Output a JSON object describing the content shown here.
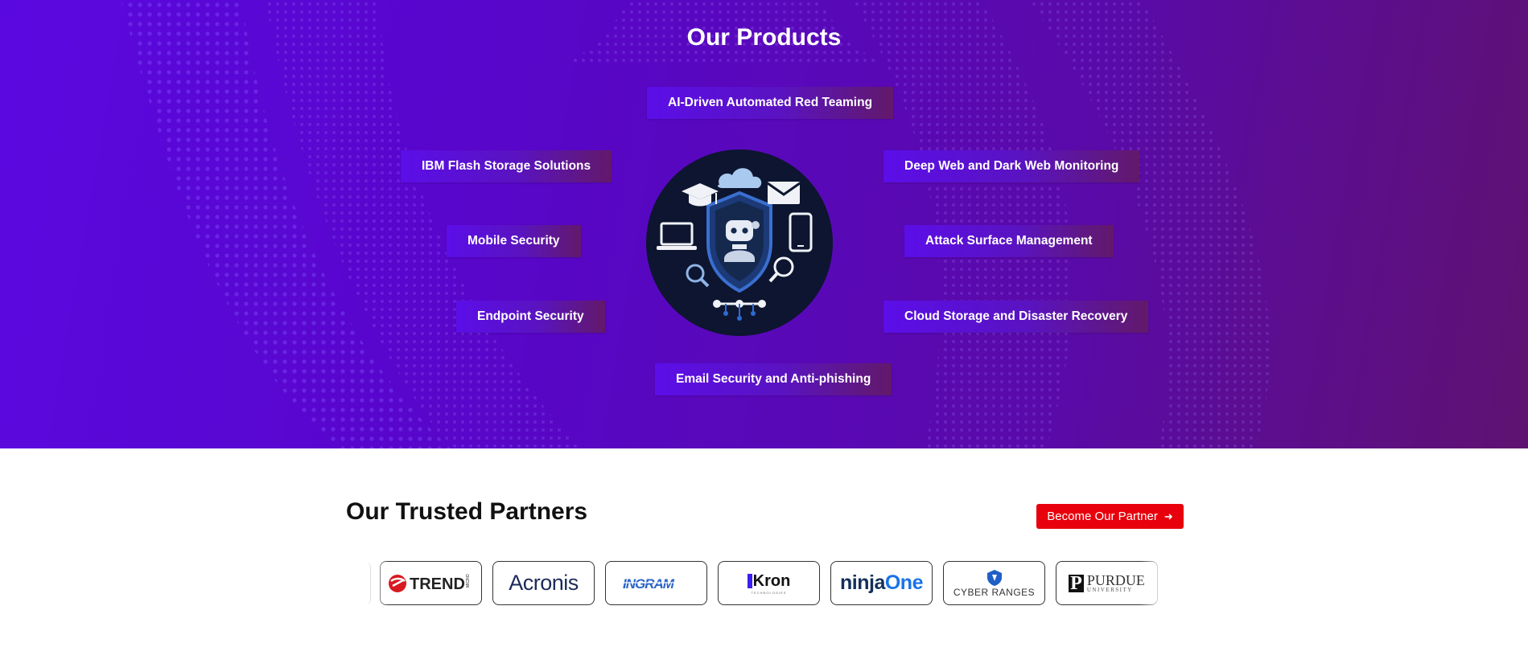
{
  "products": {
    "title": "Our Products",
    "items": [
      "AI-Driven Automated Red Teaming",
      "IBM Flash Storage Solutions",
      "Deep Web and Dark Web Monitoring",
      "Mobile Security",
      "Attack Surface Management",
      "Endpoint Security",
      "Cloud Storage and Disaster Recovery",
      "Email Security and Anti-phishing"
    ]
  },
  "partners": {
    "title": "Our Trusted Partners",
    "cta_label": "Become Our Partner",
    "cta_icon": "arrow-right-icon",
    "logos": {
      "trend": "TREND",
      "trend_small": "MICRO",
      "acronis": "Acronis",
      "ingram": "INGRAM",
      "kron": "Kron",
      "kron_sub": "TECHNOLOGIES",
      "ninja_a": "ninja",
      "ninja_b": "One",
      "cyber": "CYBER RANGES",
      "purdue": "PURDUE",
      "purdue_sub": "UNIVERSITY"
    }
  },
  "colors": {
    "accent_red": "#e8000c",
    "purple_start": "#5a08e0",
    "purple_end": "#5e1270",
    "ninja_blue": "#1a73e8"
  }
}
